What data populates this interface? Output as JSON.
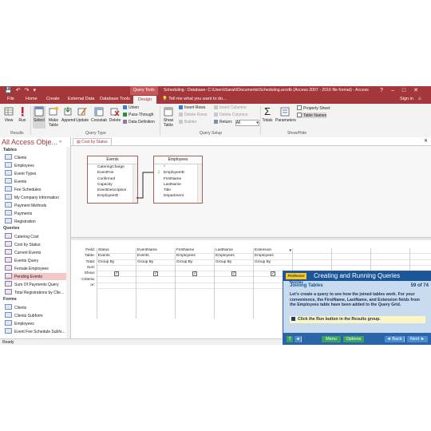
{
  "window": {
    "title": "Scheduling : Database- C:\\Users\\Sarah\\Documents\\Scheduling.accdb (Access 2007 - 2016 file format) - Access",
    "context_tab": "Query Tools"
  },
  "tabs": [
    "File",
    "Home",
    "Create",
    "External Data",
    "Database Tools",
    "Design"
  ],
  "active_tab": "Design",
  "tell_me": "Tell me what you want to do...",
  "sign_in": "Sign in",
  "ribbon": {
    "results": {
      "view": "View",
      "run": "Run",
      "label": "Results"
    },
    "query_type": {
      "select": "Select",
      "make_table": "Make Table",
      "append": "Append",
      "update": "Update",
      "crosstab": "Crosstab",
      "delete": "Delete",
      "union": "Union",
      "pass_through": "Pass-Through",
      "data_definition": "Data Definition",
      "label": "Query Type"
    },
    "query_setup": {
      "show_table": "Show Table",
      "insert_rows": "Insert Rows",
      "delete_rows": "Delete Rows",
      "builder": "Builder",
      "insert_columns": "Insert Columns",
      "delete_columns": "Delete Columns",
      "return_label": "Return:",
      "return_value": "All",
      "label": "Query Setup"
    },
    "show_hide": {
      "totals": "Totals",
      "parameters": "Parameters",
      "property_sheet": "Property Sheet",
      "table_names": "Table Names",
      "label": "Show/Hide"
    }
  },
  "nav": {
    "title": "All Access Obje...",
    "tables_label": "Tables",
    "tables": [
      "Clients",
      "Employees",
      "Event Types",
      "Events",
      "Fee Schedules",
      "My Company Information",
      "Payment Methods",
      "Payments",
      "Registration"
    ],
    "queries_label": "Queries",
    "queries": [
      "Catering Cost",
      "Cost by Status",
      "Current Events",
      "Events Query",
      "Female Employees",
      "Pending Events",
      "Sum Of Payments Query",
      "Total Registrations by Clie..."
    ],
    "selected_query": "Pending Events",
    "forms_label": "Forms",
    "forms": [
      "Clients",
      "Clients Subform",
      "Employees",
      "Event Fee Schedule Subfo..."
    ]
  },
  "document": {
    "tab": "Cost by Status",
    "events_table": {
      "name": "Events",
      "fields": [
        "CateringCharge",
        "EventFee",
        "Confirmed",
        "Capacity",
        "EventDescription",
        "EmployeeID"
      ]
    },
    "employees_table": {
      "name": "Employees",
      "fields": [
        "*",
        "EmployeeID",
        "FirstName",
        "LastName",
        "Title",
        "Department"
      ]
    },
    "row_labels": [
      "Field:",
      "Table:",
      "Total:",
      "Sort:",
      "Show:",
      "Criteria:",
      "or:"
    ],
    "columns": [
      {
        "field": "Status",
        "table": "Events",
        "total": "Group By"
      },
      {
        "field": "EventName",
        "table": "Events",
        "total": "Group By"
      },
      {
        "field": "FirstName",
        "table": "Employees",
        "total": "Group By"
      },
      {
        "field": "LastName",
        "table": "Employees",
        "total": "Group By"
      },
      {
        "field": "Extension",
        "table": "Employees",
        "total": "Group By"
      }
    ]
  },
  "tutorial": {
    "logo": "Professor Teaches",
    "title": "Creating and Running Queries",
    "subtitle": "Joining Tables",
    "page": "59 of 74",
    "body": "Let's create a query to see how the joined tables work. For your convenience, the FirstName, LastName, and Extension fields from the Employees table have been added to the Query Grid.",
    "instruction": "Click the Run button in the Results group.",
    "buttons": {
      "t": "T",
      "back_arrow": "◄",
      "menu": "Menu",
      "options": "Options",
      "back": "◄ Back",
      "next": "Next ►"
    }
  },
  "status": "Ready",
  "colors": {
    "access_red": "#a4373a",
    "tutorial_blue": "#1a5598"
  }
}
